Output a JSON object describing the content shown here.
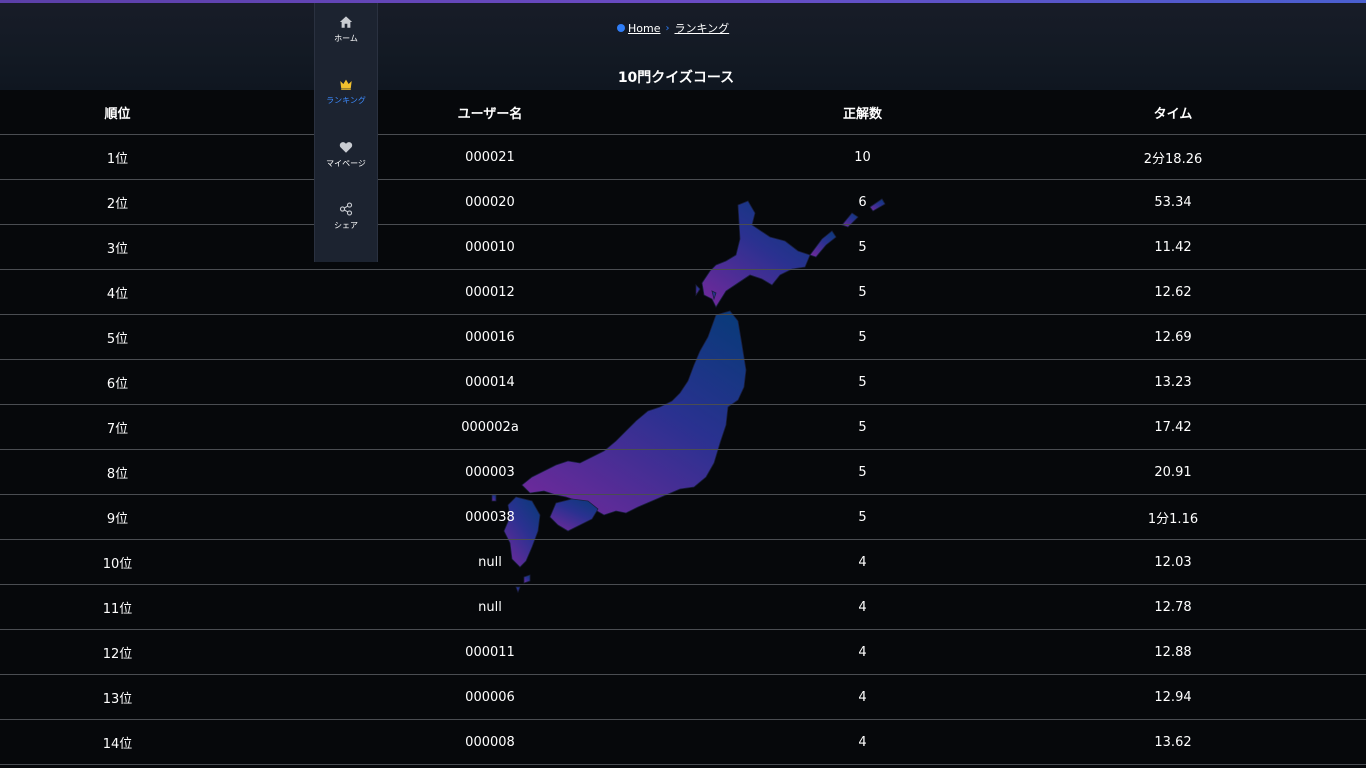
{
  "breadcrumb": {
    "home": "Home",
    "current": "ランキング"
  },
  "page_title": "10門クイズコース",
  "sidebar": {
    "items": [
      {
        "label": "ホーム",
        "icon": "home-icon"
      },
      {
        "label": "ランキング",
        "icon": "crown-icon",
        "active": true
      },
      {
        "label": "マイページ",
        "icon": "heart-icon"
      },
      {
        "label": "シェア",
        "icon": "share-icon"
      }
    ]
  },
  "table": {
    "headers": [
      "順位",
      "ユーザー名",
      "正解数",
      "タイム"
    ],
    "rows": [
      [
        "1位",
        "000021",
        "10",
        "2分18.26"
      ],
      [
        "2位",
        "000020",
        "6",
        "53.34"
      ],
      [
        "3位",
        "000010",
        "5",
        "11.42"
      ],
      [
        "4位",
        "000012",
        "5",
        "12.62"
      ],
      [
        "5位",
        "000016",
        "5",
        "12.69"
      ],
      [
        "6位",
        "000014",
        "5",
        "13.23"
      ],
      [
        "7位",
        "000002a",
        "5",
        "17.42"
      ],
      [
        "8位",
        "000003",
        "5",
        "20.91"
      ],
      [
        "9位",
        "000038",
        "5",
        "1分1.16"
      ],
      [
        "10位",
        "null",
        "4",
        "12.03"
      ],
      [
        "11位",
        "null",
        "4",
        "12.78"
      ],
      [
        "12位",
        "000011",
        "4",
        "12.88"
      ],
      [
        "13位",
        "000006",
        "4",
        "12.94"
      ],
      [
        "14位",
        "000008",
        "4",
        "13.62"
      ]
    ]
  },
  "colors": {
    "accent": "#3d8bff",
    "crown": "#f2c12e",
    "background": "#06080b",
    "map_north": "#0a3a7a",
    "map_south": "#6a2a9a"
  }
}
